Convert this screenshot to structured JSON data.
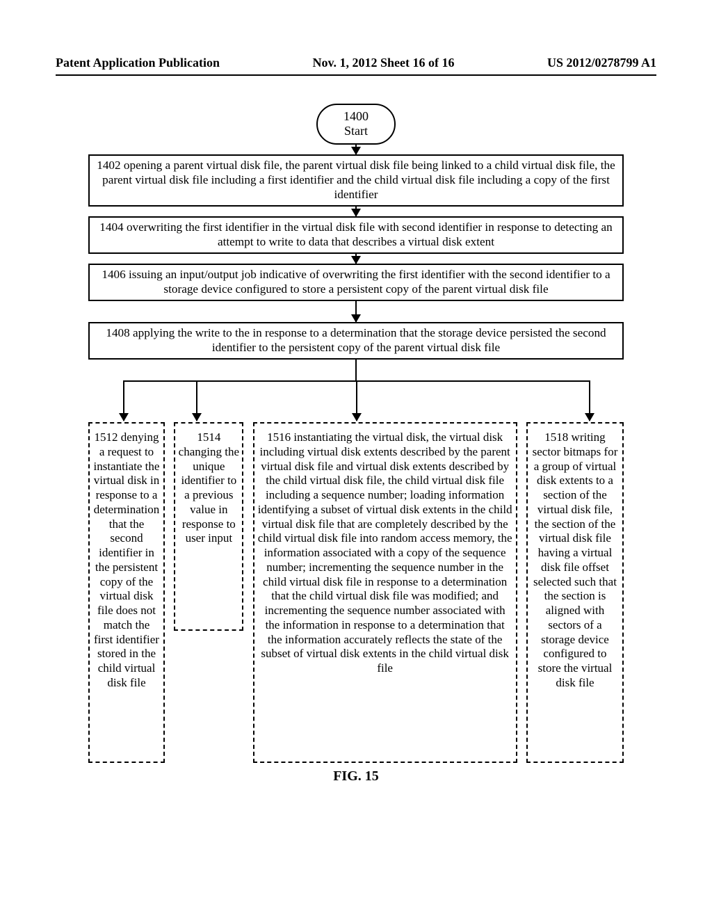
{
  "header": {
    "left": "Patent Application Publication",
    "center": "Nov. 1, 2012  Sheet 16 of 16",
    "right": "US 2012/0278799 A1"
  },
  "start": {
    "num": "1400",
    "label": "Start"
  },
  "steps": {
    "s1402": "1402 opening a parent virtual disk file, the parent virtual disk file being linked to a child virtual disk file, the parent virtual disk file including a first identifier and the child virtual disk file including a copy of the first identifier",
    "s1404": "1404 overwriting the first identifier in the virtual disk file with second identifier in response to detecting an attempt to write to data that describes a virtual disk extent",
    "s1406": "1406 issuing an input/output job indicative of overwriting the first identifier with the second identifier to a storage device configured to store a persistent copy of the parent virtual disk file",
    "s1408": "1408 applying the write to the in response to a determination that the storage device persisted the second identifier to the persistent copy of the parent virtual disk file"
  },
  "branches": {
    "b1512": "1512 denying a request to instantiate the virtual disk in response to a determination that the second identifier in the persistent copy of the virtual disk file does not match the first identifier stored in the child virtual disk file",
    "b1514": "1514 changing the unique identifier to a previous value in response to user input",
    "b1516": "1516 instantiating the virtual disk, the virtual disk including virtual disk extents described by the parent virtual disk file and virtual disk extents described by the child virtual disk file, the child virtual disk file including a sequence number; loading information identifying a subset of virtual disk extents in the child virtual disk file that are completely described by the child virtual disk file into random access memory, the information associated with a copy of the sequence number; incrementing the sequence number in the child virtual disk file in response to a determination that the child virtual disk file was modified; and incrementing the sequence number associated with the information in response to a determination that the information accurately reflects the state of the subset of virtual disk extents in the child virtual disk file",
    "b1518": "1518 writing sector bitmaps for a group of virtual disk extents to a section of the virtual disk file, the section of the virtual disk file having a virtual disk file offset selected such that the section is aligned with sectors of a storage device configured to store the virtual disk file"
  },
  "figure_label": "FIG. 15"
}
